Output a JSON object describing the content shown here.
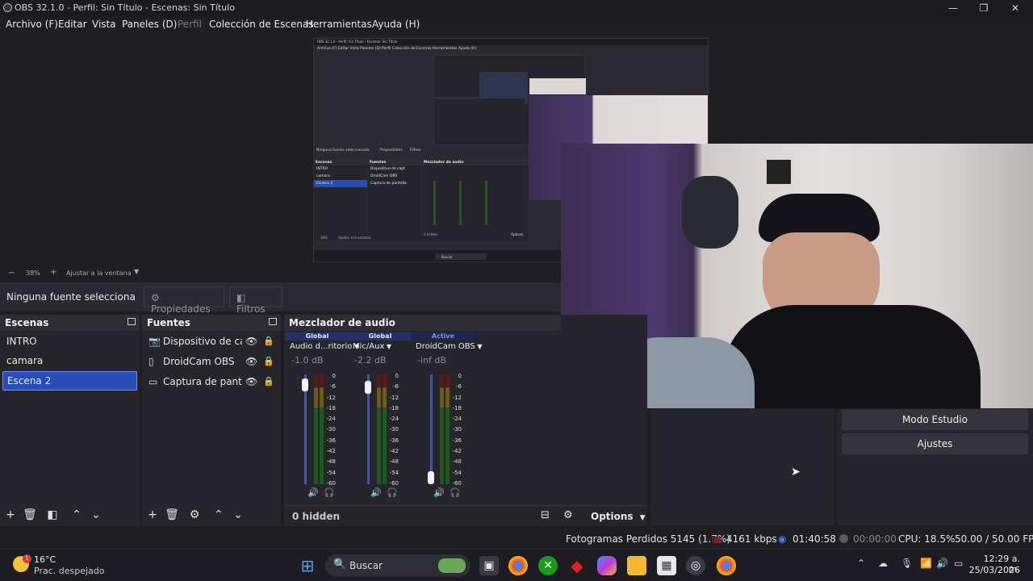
{
  "window": {
    "title": "OBS 32.1.0 - Perfil: Sin Título - Escenas: Sin Título",
    "minimize_glyph": "—",
    "maximize_glyph": "❐",
    "close_glyph": "✕"
  },
  "menu": {
    "items": [
      "Archivo (F)",
      "Editar",
      "Vista",
      "Paneles (D)",
      "Perfil",
      "Colección de Escenas",
      "Herramientas",
      "Ayuda (H)"
    ]
  },
  "zoom": {
    "minus": "−",
    "value": "38%",
    "plus": "+",
    "fit": "Ajustar a la ventana"
  },
  "context": {
    "no_source": "Ninguna fuente selecciona",
    "properties": "Propiedades",
    "filters": "Filtros"
  },
  "scenes": {
    "title": "Escenas",
    "items": [
      "INTRO",
      "camara",
      "Escena 2"
    ],
    "selected_index": 2
  },
  "sources": {
    "title": "Fuentes",
    "items": [
      {
        "label": "Dispositivo de capt",
        "icon": "camera-icon"
      },
      {
        "label": "DroidCam OBS",
        "icon": "file-icon"
      },
      {
        "label": "Captura de pantalla",
        "icon": "monitor-icon"
      }
    ]
  },
  "mixer": {
    "title": "Mezclador de audio",
    "channels": [
      {
        "scope": "Global",
        "name": "Audio d...ritorio",
        "db": "-1.0 dB",
        "level": 0.96
      },
      {
        "scope": "Global",
        "name": "Mic/Aux",
        "db": "-2.2 dB",
        "level": 0.93
      },
      {
        "scope": "Active",
        "name": "DroidCam OBS",
        "db": "-inf dB",
        "level": 0.0
      }
    ],
    "scale": [
      "0",
      "-6",
      "-12",
      "-18",
      "-24",
      "-30",
      "-36",
      "-42",
      "-48",
      "-54",
      "-60"
    ],
    "hidden": "0 hidden",
    "options": "Options"
  },
  "controls": {
    "studio_mode": "Modo Estudio",
    "settings": "Ajustes"
  },
  "status": {
    "dropped": "Fotogramas Perdidos 5145 (1.7%)",
    "bitrate": "4161 kbps",
    "stream_time": "01:40:58",
    "rec_time": "00:00:00",
    "cpu": "CPU: 18.5%",
    "fps": "50.00 / 50.00 FPS"
  },
  "taskbar": {
    "weather_temp": "16°C",
    "weather_desc": "Prac. despejado",
    "weather_badge": "1",
    "search": "Buscar",
    "time": "12:29 a. m.",
    "date": "25/03/2026"
  },
  "nested": {
    "title": "OBS 32.1.0 - Perfil: Sin Título - Escenas: Sin Título",
    "menu": "Archivo (F)   Editar   Vista   Paneles (D)   Perfil   Colección de Escenas   Herramientas   Ayuda (H)",
    "no_source": "Ninguna fuente seleccionada",
    "properties": "Propiedades",
    "filters": "Filtros",
    "scenes_title": "Escenas",
    "scenes": [
      "INTRO",
      "camara",
      "Escena 2"
    ],
    "sources_title": "Fuentes",
    "sources": [
      "Dispositivo de capt",
      "DroidCam OBS",
      "Captura de pantalla"
    ],
    "mixer_title": "Mezclador de audio",
    "zoom_value": "38%",
    "zoom_fit": "Ajustar a la ventana",
    "hidden": "0 hidden",
    "options": "Options",
    "search": "Buscar"
  }
}
